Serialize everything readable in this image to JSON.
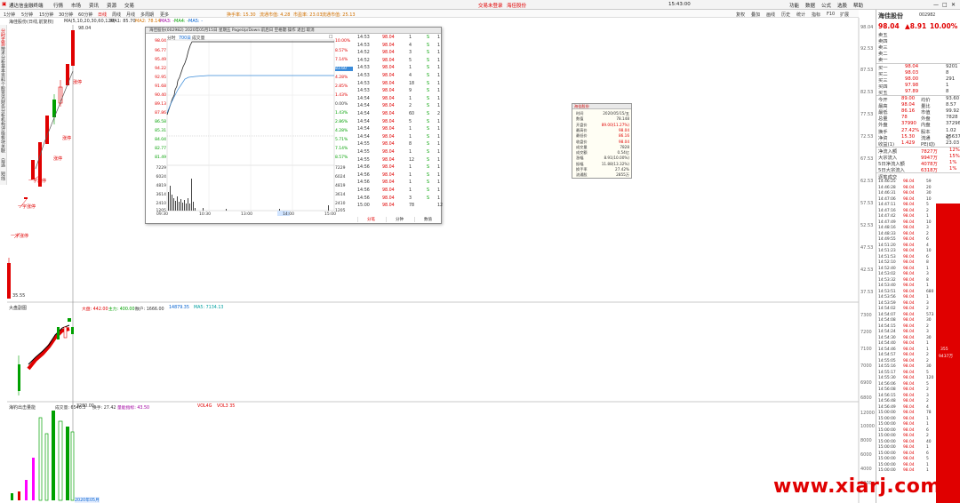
{
  "topbar": {
    "window_title": "通达信金融终端",
    "menus": [
      "行情",
      "市场",
      "资讯",
      "资源",
      "交易"
    ],
    "center_left": "交易未登录",
    "center_right": "海佳股份",
    "right_items": [
      "功能",
      "数据",
      "公式",
      "选股",
      "帮助"
    ],
    "clock": "15:43:00"
  },
  "toolbar": {
    "items": [
      "1分钟",
      "5分钟",
      "15分钟",
      "30分钟",
      "60分钟",
      "日线",
      "周线",
      "月线",
      "多周期",
      "更多"
    ],
    "right_items": [
      "复权",
      "叠加",
      "画线",
      "历史",
      "统计",
      "指标",
      "F10",
      "扩展"
    ],
    "indicators": [
      "换手率: 15.30",
      "流通市值: 4.28",
      "市盈率: 23.03",
      "流通市值: 25.13"
    ]
  },
  "maline": {
    "title": "海佳股份(日线,前复权)",
    "ma_label": "MA(5,10,20,30,60,120)",
    "ma1": "MA1: 85.70",
    "ma2": "MA2: 78.14",
    "ma3": "MA3: -",
    "ma4": "MA4: -",
    "ma5": "MA5: -"
  },
  "left_tabs": [
    "分时走势",
    "技术分析",
    "基本资料",
    "个股资讯",
    "财务分析",
    "机构评级",
    "板块关联",
    "自选",
    "短线"
  ],
  "main_labels": {
    "high_price": "98.04",
    "low_price": "35.55",
    "limit_labels": [
      "涨停",
      "涨停",
      "涨停",
      "一字涨停",
      "一字涨停",
      "一字涨停"
    ],
    "volume_panel": "大盘副图",
    "sub_values": [
      "大盘: 442.00",
      "主力: 400.00",
      "散户: 1666.00",
      "14879.35",
      "MA5: 7134.13"
    ],
    "vol_panel": "海钓出击量能",
    "vol_values": [
      "成交量: 6540.3",
      "3280.00",
      "换手: 27.42",
      "量能指标: 43.50"
    ],
    "vol_labels": [
      "VOL4G",
      "VOL3 35"
    ],
    "date_label": "2020年05月"
  },
  "right_axis_main": [
    "98.04",
    "92.53",
    "87.53",
    "82.53",
    "77.53",
    "72.53",
    "67.53",
    "62.53",
    "57.53",
    "52.53",
    "47.53",
    "42.53",
    "37.53"
  ],
  "right_axis_mid": [
    "7300",
    "7200",
    "7100",
    "7000",
    "6900",
    "6800"
  ],
  "right_axis_vol": [
    "12000",
    "10000",
    "8000",
    "6000",
    "4000",
    "2000"
  ],
  "popup": {
    "title": "海佳股份(002982) 2020年05月15日 星期五 PageUp/Down:前后日 空格键:操作 退出:取消",
    "tabs": [
      "分时",
      "700日",
      "成交量"
    ],
    "left_axis": [
      "98.04",
      "96.77",
      "95.49",
      "94.22",
      "92.95",
      "91.68",
      "90.40",
      "89.13",
      "87.86",
      "86.58",
      "85.31",
      "84.04",
      "82.77",
      "81.49",
      "80.22",
      "79.95"
    ],
    "right_axis": [
      "10.00%",
      "8.57%",
      "7.14%",
      "5.71%",
      "4.28%",
      "2.85%",
      "1.43%",
      "0.00%",
      "1.43%",
      "2.86%",
      "4.28%",
      "5.71%",
      "7.14%",
      "8.57%",
      "10.00%"
    ],
    "vol_axis_left": [
      "7229",
      "6024",
      "4819",
      "3614",
      "2410",
      "1205"
    ],
    "vol_axis_right": [
      "7229",
      "6024",
      "4819",
      "3614",
      "2410",
      "1205"
    ],
    "time_labels": [
      "09:30",
      "10:30",
      "13:00",
      "14:00",
      "15:00"
    ],
    "cursor_price": "83.60",
    "buttons": [
      "分笔",
      "分钟",
      "数值"
    ],
    "ticks": [
      [
        "14:53",
        "98.04",
        "1",
        "S",
        "1"
      ],
      [
        "14:53",
        "98.04",
        "4",
        "S",
        "1"
      ],
      [
        "14:52",
        "98.04",
        "3",
        "S",
        "1"
      ],
      [
        "14:52",
        "98.04",
        "5",
        "S",
        "1"
      ],
      [
        "14:53",
        "98.04",
        "1",
        "S",
        "1"
      ],
      [
        "14:53",
        "98.04",
        "4",
        "S",
        "1"
      ],
      [
        "14:53",
        "98.04",
        "18",
        "S",
        "1"
      ],
      [
        "14:53",
        "98.04",
        "9",
        "S",
        "1"
      ],
      [
        "14:54",
        "98.04",
        "1",
        "S",
        "1"
      ],
      [
        "14:54",
        "98.04",
        "2",
        "S",
        "1"
      ],
      [
        "14:54",
        "98.04",
        "60",
        "S",
        "2"
      ],
      [
        "14:54",
        "98.04",
        "5",
        "S",
        "1"
      ],
      [
        "14:54",
        "98.04",
        "1",
        "S",
        "1"
      ],
      [
        "14:54",
        "98.04",
        "1",
        "S",
        "1"
      ],
      [
        "14:55",
        "98.04",
        "8",
        "S",
        "1"
      ],
      [
        "14:55",
        "98.04",
        "1",
        "S",
        "1"
      ],
      [
        "14:55",
        "98.04",
        "12",
        "S",
        "1"
      ],
      [
        "14:56",
        "98.04",
        "1",
        "S",
        "1"
      ],
      [
        "14:56",
        "98.04",
        "1",
        "S",
        "1"
      ],
      [
        "14:56",
        "98.04",
        "1",
        "S",
        "1"
      ],
      [
        "14:56",
        "98.04",
        "1",
        "S",
        "1"
      ],
      [
        "14:56",
        "98.04",
        "3",
        "S",
        "1"
      ],
      [
        "15:00",
        "98.04",
        "78",
        "",
        "12"
      ]
    ]
  },
  "infobox": {
    "title": "海佳股份",
    "rows": [
      [
        "时间",
        "2020/05/15/五"
      ],
      [
        "数值",
        "78.148"
      ],
      [
        "开盘价",
        "89.00(11.27%)"
      ],
      [
        "最高价",
        "98.04"
      ],
      [
        "最低价",
        "86.16"
      ],
      [
        "收盘价",
        "98.04"
      ],
      [
        "成交量",
        "7828"
      ],
      [
        "成交额",
        "0.54亿"
      ],
      [
        "涨幅",
        "8.91(10.00%)"
      ],
      [
        "振幅",
        "11.88(13.32%)"
      ],
      [
        "换手率",
        "27.42%"
      ],
      [
        "流通股",
        "2855万"
      ]
    ]
  },
  "rpanel": {
    "name": "海佳股份",
    "code": "002982",
    "price": "98.04",
    "change": "▲8.91",
    "pct": "10.00%",
    "sells": [
      [
        "卖五",
        "",
        ""
      ],
      [
        "卖四",
        "",
        ""
      ],
      [
        "卖三",
        "",
        ""
      ],
      [
        "卖二",
        "",
        ""
      ],
      [
        "卖一",
        "",
        ""
      ]
    ],
    "buys": [
      [
        "买一",
        "98.04",
        "9201"
      ],
      [
        "买二",
        "98.03",
        "8"
      ],
      [
        "买三",
        "98.00",
        "291"
      ],
      [
        "买四",
        "97.98",
        "1"
      ],
      [
        "买五",
        "97.89",
        "8"
      ]
    ],
    "stats": [
      [
        "今开",
        "89.00",
        "均价",
        "93.60"
      ],
      [
        "最高",
        "98.04",
        "量比",
        "8.57"
      ],
      [
        "最低",
        "86.16",
        "市值",
        "99.92"
      ],
      [
        "总量",
        "78",
        "外盘",
        "7828"
      ],
      [
        "外盘",
        "37990",
        "内盘",
        "37296"
      ],
      [
        "换手",
        "27.42%",
        "股本",
        "1.02亿"
      ],
      [
        "净资",
        "15.30",
        "流通",
        "25637"
      ],
      [
        "收益(1)",
        "1.429",
        "PE(动)",
        "23.03"
      ]
    ],
    "flows": [
      [
        "净流入额",
        "7827万",
        "12%"
      ],
      [
        "大宗流入",
        "9947万",
        "15%"
      ],
      [
        "5日净流入额",
        "4078万",
        "1%"
      ],
      [
        "5日大宗流入",
        "6318万",
        "1%"
      ]
    ],
    "trade_header": "逐笔成交",
    "trades": [
      [
        "14:46:25",
        "98.04",
        "59"
      ],
      [
        "14:46:28",
        "98.04",
        "20"
      ],
      [
        "14:46:31",
        "98.04",
        "30"
      ],
      [
        "14:47:06",
        "98.04",
        "10"
      ],
      [
        "14:47:11",
        "98.04",
        "5"
      ],
      [
        "14:47:16",
        "98.04",
        "2"
      ],
      [
        "14:47:42",
        "98.04",
        "1"
      ],
      [
        "14:47:49",
        "98.04",
        "10"
      ],
      [
        "14:48:16",
        "98.04",
        "3"
      ],
      [
        "14:48:33",
        "98.04",
        "2"
      ],
      [
        "14:49:55",
        "98.04",
        "6"
      ],
      [
        "14:51:20",
        "98.04",
        "4"
      ],
      [
        "14:51:23",
        "98.04",
        "10"
      ],
      [
        "14:51:53",
        "98.04",
        "6"
      ],
      [
        "14:52:10",
        "98.04",
        "8"
      ],
      [
        "14:52:40",
        "98.04",
        "1"
      ],
      [
        "14:53:02",
        "98.04",
        "3"
      ],
      [
        "14:53:32",
        "98.04",
        "8"
      ],
      [
        "14:53:40",
        "98.04",
        "1"
      ],
      [
        "14:53:51",
        "98.04",
        "680"
      ],
      [
        "14:53:56",
        "98.04",
        "1"
      ],
      [
        "14:53:59",
        "98.04",
        "3"
      ],
      [
        "14:54:02",
        "98.04",
        "2"
      ],
      [
        "14:54:07",
        "98.04",
        "573"
      ],
      [
        "14:54:08",
        "98.04",
        "30"
      ],
      [
        "14:54:15",
        "98.04",
        "2"
      ],
      [
        "14:54:24",
        "98.04",
        "3"
      ],
      [
        "14:54:30",
        "98.04",
        "30"
      ],
      [
        "14:54:40",
        "98.04",
        "1"
      ],
      [
        "14:54:46",
        "98.04",
        "1"
      ],
      [
        "14:54:57",
        "98.04",
        "2"
      ],
      [
        "14:55:05",
        "98.04",
        "2"
      ],
      [
        "14:55:16",
        "98.04",
        "30"
      ],
      [
        "14:55:17",
        "98.04",
        "5"
      ],
      [
        "14:55:30",
        "98.04",
        "120"
      ],
      [
        "14:56:06",
        "98.04",
        "5"
      ],
      [
        "14:56:08",
        "98.04",
        "2"
      ],
      [
        "14:56:15",
        "98.04",
        "3"
      ],
      [
        "14:56:48",
        "98.04",
        "2"
      ],
      [
        "14:56:49",
        "98.04",
        "4"
      ],
      [
        "15:00:00",
        "98.04",
        "78"
      ],
      [
        "15:00:00",
        "98.04",
        "1"
      ],
      [
        "15:00:00",
        "98.04",
        "1"
      ],
      [
        "15:00:00",
        "98.04",
        "6"
      ],
      [
        "15:00:00",
        "98.04",
        "2"
      ],
      [
        "15:00:00",
        "98.04",
        "40"
      ],
      [
        "15:00:00",
        "98.04",
        "1"
      ],
      [
        "15:00:00",
        "98.04",
        "6"
      ],
      [
        "15:00:00",
        "98.04",
        "5"
      ],
      [
        "15:00:00",
        "98.04",
        "1"
      ],
      [
        "15:00:00",
        "98.04",
        "1"
      ]
    ],
    "side_bar_label": "355",
    "side_bar_label2": "9437万"
  },
  "watermark": "www.xiarj.com",
  "colors": {
    "up": "#e00000",
    "down": "#00a000",
    "accent": "#0060d0"
  }
}
